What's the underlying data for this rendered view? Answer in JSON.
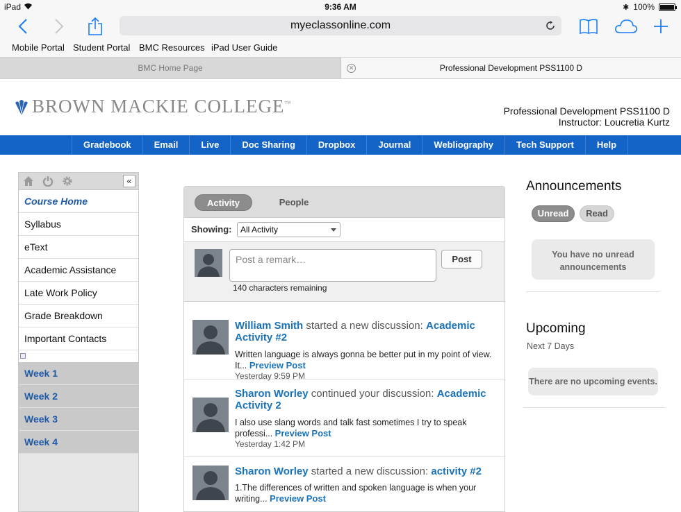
{
  "status": {
    "device": "iPad",
    "time": "9:36 AM",
    "battery": "100%"
  },
  "browser": {
    "url": "myeclassonline.com",
    "bookmarks": [
      "Mobile Portal",
      "Student Portal",
      "BMC Resources",
      "iPad User Guide"
    ],
    "tabs": [
      {
        "label": "BMC Home Page",
        "active": false
      },
      {
        "label": "Professional Development PSS1100 D",
        "active": true
      }
    ]
  },
  "college": {
    "name": "BROWN MACKIE COLLEGE",
    "tm": "™",
    "course": "Professional Development PSS1100 D",
    "instructor": "Instructor:  Loucretia Kurtz"
  },
  "nav": [
    "Gradebook",
    "Email",
    "Live",
    "Doc Sharing",
    "Dropbox",
    "Journal",
    "Webliography",
    "Tech Support",
    "Help"
  ],
  "sidebar": {
    "items": [
      "Course Home",
      "Syllabus",
      "eText",
      "Academic Assistance",
      "Late Work Policy",
      "Grade Breakdown",
      "Important Contacts"
    ],
    "collapse": "«",
    "weeks": [
      "Week 1",
      "Week 2",
      "Week 3",
      "Week 4"
    ]
  },
  "activity": {
    "tabs": [
      "Activity",
      "People"
    ],
    "showing_label": "Showing:",
    "filter": "All Activity",
    "remark_placeholder": "Post a remark…",
    "post_label": "Post",
    "chars_remaining": "140 characters remaining",
    "feed": [
      {
        "user": "William Smith",
        "action": " started a new discussion: ",
        "topic": "Academic Activity #2",
        "body": "Written language is always gonna be better put in my point of view. It...",
        "preview": "Preview Post",
        "time": "Yesterday 9:59 PM"
      },
      {
        "user": "Sharon Worley",
        "action": " continued your discussion: ",
        "topic": "Academic Activity 2",
        "body": "I also use slang words and talk fast sometimes I try to speak professi...",
        "preview": "Preview Post",
        "time": "Yesterday 1:42 PM"
      },
      {
        "user": "Sharon Worley",
        "action": " started a new discussion: ",
        "topic": "activity #2",
        "body": "1.The differences of written and spoken language is when your writing...",
        "preview": "Preview Post",
        "time": ""
      }
    ]
  },
  "announcements": {
    "title": "Announcements",
    "tabs": [
      "Unread",
      "Read"
    ],
    "empty": "You have no unread announcements"
  },
  "upcoming": {
    "title": "Upcoming",
    "range": "Next 7 Days",
    "empty": "There are no upcoming events."
  },
  "colors": {
    "nav": "#1463c7",
    "link": "#1a72b8",
    "sidebar_link": "#1e5aa8"
  }
}
